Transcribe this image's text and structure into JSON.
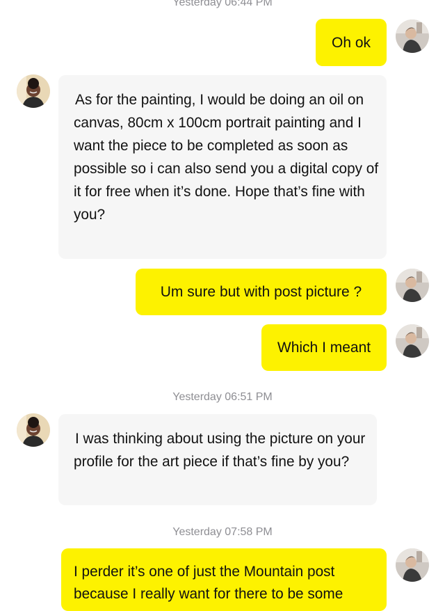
{
  "chat": {
    "timestamps": {
      "t1": "Yesterday 06:44 PM",
      "t2": "Yesterday 06:51 PM",
      "t3": "Yesterday 07:58 PM"
    },
    "messages": {
      "m1": "Oh ok",
      "m2": "As for the painting, I would be doing an oil on canvas, 80cm x 100cm portrait painting and I want the piece to be completed as soon as possible so i can also send you a digital copy of it for free when it’s done. Hope that’s fine with you?",
      "m3": "Um sure but with post picture ?",
      "m4": "Which I meant",
      "m5": "I was thinking about using the picture on your profile for the art piece if that’s fine by you?",
      "m6": "I perder it’s one of just the Mountain post because I really want for there to be some"
    }
  },
  "colors": {
    "outgoing_bubble": "#fdf200",
    "incoming_bubble": "#f6f6f6",
    "timestamp_text": "#8e8e93"
  },
  "icons": {
    "self_avatar": "user-avatar-photo",
    "contact_avatar": "contact-avatar-photo"
  }
}
